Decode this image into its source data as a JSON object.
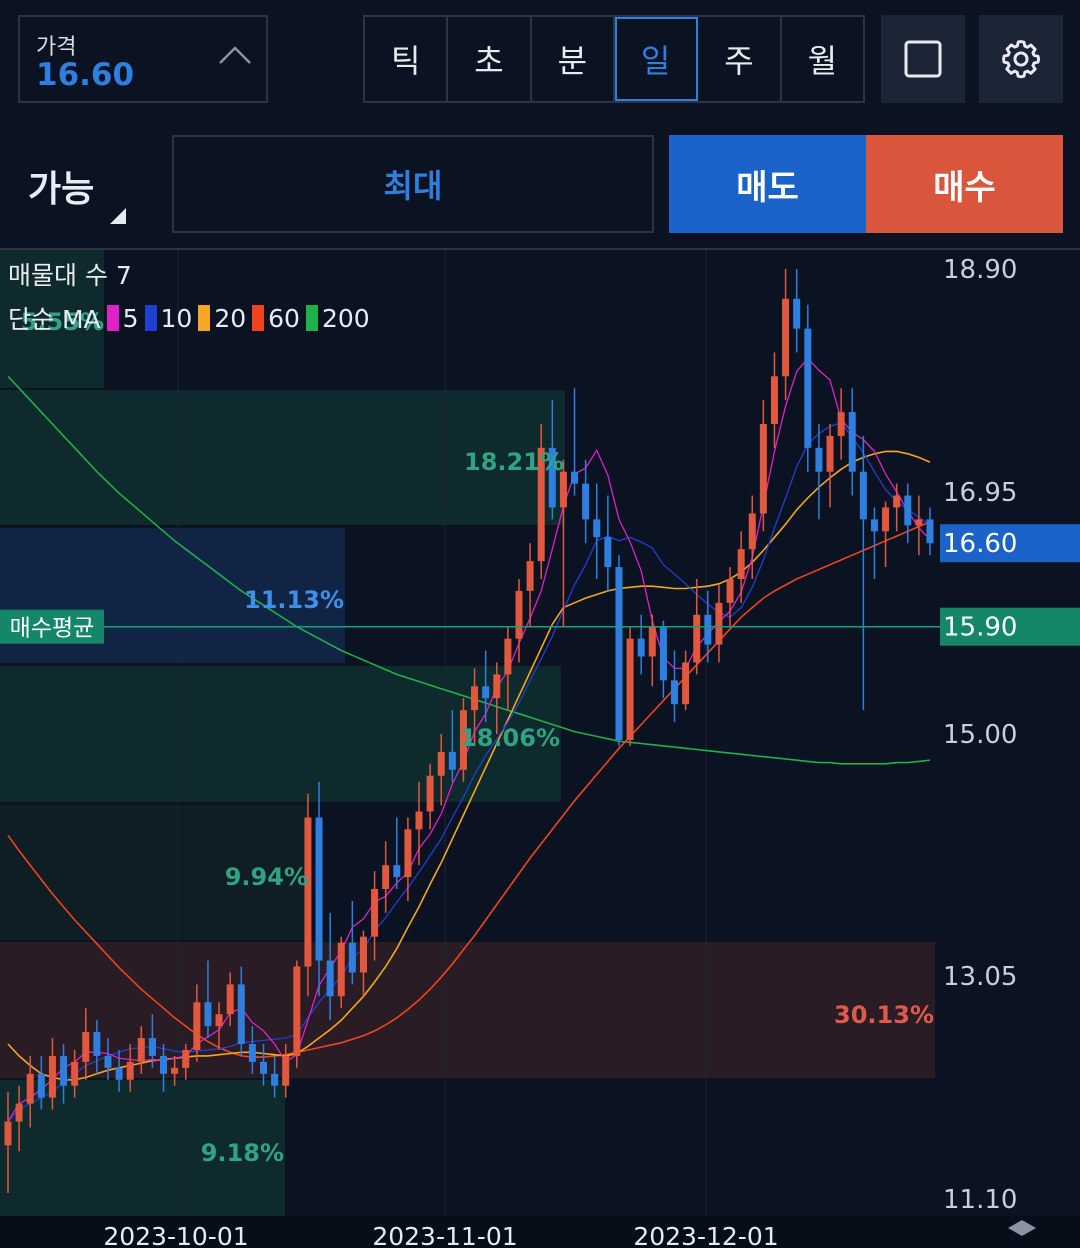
{
  "header": {
    "price_label": "가격",
    "price_value": "16.60",
    "timeframes": [
      {
        "label": "틱",
        "active": false
      },
      {
        "label": "초",
        "active": false
      },
      {
        "label": "분",
        "active": false
      },
      {
        "label": "일",
        "active": true
      },
      {
        "label": "주",
        "active": false
      },
      {
        "label": "월",
        "active": false
      }
    ],
    "fullscreen_icon": "square-icon",
    "settings_icon": "gear-icon"
  },
  "order": {
    "available_label": "가능",
    "max_label": "최대",
    "sell_label": "매도",
    "buy_label": "매수"
  },
  "indicators": {
    "volume_profile": "매물대 수 7",
    "ma_label": "단순 MA",
    "ma_periods": [
      {
        "period": "5",
        "color": "#e020c8"
      },
      {
        "period": "10",
        "color": "#1f3fd0"
      },
      {
        "period": "20",
        "color": "#f5a623"
      },
      {
        "period": "60",
        "color": "#f0441c"
      },
      {
        "period": "200",
        "color": "#1fb04a"
      }
    ]
  },
  "chart_data": {
    "type": "candlestick",
    "y_ticks": [
      "18.90",
      "16.95",
      "15.00",
      "13.05",
      "11.10"
    ],
    "x_ticks": [
      "2023-10-01",
      "2023-11-01",
      "2023-12-01"
    ],
    "ylim": [
      11.1,
      18.9
    ],
    "current_price": {
      "label": "16.60",
      "value": 16.6,
      "color": "#1b63c8"
    },
    "average_buy": {
      "label": "매수평균",
      "value_label": "15.90",
      "value": 15.9,
      "color": "#15a27a"
    },
    "volume_profile_percents": [
      "5.55%",
      "18.21%",
      "11.13%",
      "18.06%",
      "9.94%",
      "30.13%",
      "9.18%"
    ],
    "candle_colors": {
      "up": "#e2583e",
      "down": "#2f7fe0"
    },
    "candles": [
      [
        11.55,
        12.0,
        11.15,
        11.75
      ],
      [
        11.75,
        12.05,
        11.5,
        11.9
      ],
      [
        11.9,
        12.3,
        11.7,
        12.15
      ],
      [
        12.15,
        12.3,
        11.85,
        11.95
      ],
      [
        11.95,
        12.45,
        11.85,
        12.3
      ],
      [
        12.3,
        12.4,
        11.9,
        12.05
      ],
      [
        12.05,
        12.35,
        11.95,
        12.25
      ],
      [
        12.25,
        12.7,
        12.1,
        12.5
      ],
      [
        12.5,
        12.6,
        12.15,
        12.3
      ],
      [
        12.3,
        12.45,
        12.1,
        12.2
      ],
      [
        12.2,
        12.35,
        12.0,
        12.1
      ],
      [
        12.1,
        12.4,
        12.0,
        12.25
      ],
      [
        12.25,
        12.55,
        12.15,
        12.45
      ],
      [
        12.45,
        12.65,
        12.2,
        12.3
      ],
      [
        12.3,
        12.4,
        12.0,
        12.15
      ],
      [
        12.15,
        12.3,
        12.05,
        12.2
      ],
      [
        12.2,
        12.4,
        12.1,
        12.35
      ],
      [
        12.35,
        12.9,
        12.25,
        12.75
      ],
      [
        12.75,
        13.1,
        12.45,
        12.55
      ],
      [
        12.55,
        12.75,
        12.35,
        12.65
      ],
      [
        12.65,
        13.0,
        12.55,
        12.9
      ],
      [
        12.9,
        13.05,
        12.3,
        12.4
      ],
      [
        12.4,
        12.55,
        12.15,
        12.25
      ],
      [
        12.25,
        12.4,
        12.05,
        12.15
      ],
      [
        12.15,
        12.3,
        11.95,
        12.05
      ],
      [
        12.05,
        12.4,
        11.95,
        12.3
      ],
      [
        12.3,
        13.1,
        12.2,
        13.05
      ],
      [
        13.05,
        14.5,
        12.8,
        14.3
      ],
      [
        14.3,
        14.6,
        12.8,
        13.1
      ],
      [
        13.1,
        13.5,
        12.6,
        12.8
      ],
      [
        12.8,
        13.3,
        12.7,
        13.25
      ],
      [
        13.25,
        13.6,
        12.9,
        13.0
      ],
      [
        13.0,
        13.35,
        12.8,
        13.3
      ],
      [
        13.3,
        13.85,
        13.1,
        13.7
      ],
      [
        13.7,
        14.1,
        13.5,
        13.9
      ],
      [
        13.9,
        14.3,
        13.7,
        13.8
      ],
      [
        13.8,
        14.3,
        13.6,
        14.2
      ],
      [
        14.2,
        14.6,
        13.9,
        14.35
      ],
      [
        14.35,
        14.75,
        14.2,
        14.65
      ],
      [
        14.65,
        15.0,
        14.4,
        14.85
      ],
      [
        14.85,
        15.2,
        14.6,
        14.7
      ],
      [
        14.7,
        15.3,
        14.6,
        15.2
      ],
      [
        15.2,
        15.55,
        14.9,
        15.4
      ],
      [
        15.4,
        15.7,
        15.1,
        15.3
      ],
      [
        15.3,
        15.6,
        15.0,
        15.5
      ],
      [
        15.5,
        15.9,
        15.2,
        15.8
      ],
      [
        15.8,
        16.3,
        15.6,
        16.2
      ],
      [
        16.2,
        16.6,
        15.9,
        16.45
      ],
      [
        16.45,
        17.6,
        16.3,
        17.4
      ],
      [
        17.4,
        17.8,
        16.8,
        16.9
      ],
      [
        16.9,
        17.3,
        15.9,
        17.2
      ],
      [
        17.2,
        17.9,
        17.0,
        17.1
      ],
      [
        17.1,
        17.3,
        16.6,
        16.8
      ],
      [
        16.8,
        17.1,
        16.3,
        16.65
      ],
      [
        16.65,
        17.0,
        16.2,
        16.4
      ],
      [
        16.4,
        16.5,
        14.9,
        14.95
      ],
      [
        14.95,
        15.9,
        14.9,
        15.8
      ],
      [
        15.8,
        16.0,
        15.5,
        15.65
      ],
      [
        15.65,
        16.0,
        15.4,
        15.9
      ],
      [
        15.9,
        15.95,
        15.3,
        15.45
      ],
      [
        15.45,
        15.7,
        15.1,
        15.25
      ],
      [
        15.25,
        15.7,
        15.2,
        15.6
      ],
      [
        15.6,
        16.3,
        15.5,
        16.0
      ],
      [
        16.0,
        16.2,
        15.6,
        15.75
      ],
      [
        15.75,
        16.25,
        15.6,
        16.1
      ],
      [
        16.1,
        16.4,
        15.9,
        16.3
      ],
      [
        16.3,
        16.7,
        16.1,
        16.55
      ],
      [
        16.55,
        17.0,
        16.3,
        16.85
      ],
      [
        16.85,
        17.8,
        16.7,
        17.6
      ],
      [
        17.6,
        18.2,
        17.4,
        18.0
      ],
      [
        18.0,
        18.9,
        17.8,
        18.65
      ],
      [
        18.65,
        18.9,
        18.2,
        18.4
      ],
      [
        18.4,
        18.6,
        17.2,
        17.4
      ],
      [
        17.4,
        17.6,
        16.8,
        17.2
      ],
      [
        17.2,
        17.6,
        16.9,
        17.5
      ],
      [
        17.5,
        17.9,
        17.3,
        17.7
      ],
      [
        17.7,
        17.9,
        17.0,
        17.2
      ],
      [
        17.2,
        17.5,
        15.2,
        16.8
      ],
      [
        16.8,
        16.9,
        16.3,
        16.7
      ],
      [
        16.7,
        16.95,
        16.4,
        16.9
      ],
      [
        16.9,
        17.1,
        16.7,
        17.0
      ],
      [
        17.0,
        17.1,
        16.6,
        16.75
      ],
      [
        16.75,
        17.0,
        16.5,
        16.8
      ],
      [
        16.8,
        16.9,
        16.5,
        16.6
      ]
    ],
    "ma_values": {
      "ma5": [
        11.75,
        11.9,
        11.95,
        12.02,
        12.1,
        12.2,
        12.25,
        12.33,
        12.33,
        12.32,
        12.28,
        12.27,
        12.26,
        12.27,
        12.26,
        12.28,
        12.3,
        12.4,
        12.46,
        12.52,
        12.66,
        12.7,
        12.58,
        12.51,
        12.4,
        12.25,
        12.31,
        12.6,
        12.89,
        13.04,
        13.18,
        13.38,
        13.45,
        13.59,
        13.64,
        13.75,
        13.84,
        14.04,
        14.16,
        14.33,
        14.58,
        14.77,
        15.02,
        15.17,
        15.39,
        15.53,
        15.76,
        15.97,
        16.2,
        16.55,
        16.91,
        17.18,
        17.23,
        17.38,
        17.17,
        16.8,
        16.61,
        16.37,
        15.95,
        15.64,
        15.55,
        15.55,
        15.73,
        15.84,
        15.94,
        16.03,
        16.19,
        16.48,
        16.92,
        17.37,
        17.75,
        18.04,
        18.15,
        18.05,
        17.97,
        17.64,
        17.53,
        17.47,
        17.37,
        17.18,
        17.03,
        16.87,
        16.73,
        16.63
      ],
      "ma10": [
        11.75,
        11.85,
        11.9,
        11.95,
        12.0,
        12.08,
        12.15,
        12.22,
        12.26,
        12.3,
        12.33,
        12.36,
        12.37,
        12.38,
        12.36,
        12.34,
        12.33,
        12.34,
        12.35,
        12.36,
        12.38,
        12.41,
        12.42,
        12.43,
        12.44,
        12.45,
        12.48,
        12.62,
        12.75,
        12.86,
        12.97,
        13.12,
        13.2,
        13.35,
        13.46,
        13.59,
        13.71,
        13.84,
        13.98,
        14.12,
        14.3,
        14.47,
        14.66,
        14.82,
        14.96,
        15.1,
        15.26,
        15.45,
        15.63,
        15.82,
        16.04,
        16.25,
        16.42,
        16.62,
        16.66,
        16.62,
        16.65,
        16.61,
        16.56,
        16.42,
        16.34,
        16.26,
        16.17,
        16.09,
        16.02,
        15.98,
        16.06,
        16.23,
        16.46,
        16.73,
        16.98,
        17.24,
        17.43,
        17.52,
        17.58,
        17.61,
        17.49,
        17.36,
        17.2,
        17.05,
        16.95,
        16.88,
        16.82,
        16.75
      ],
      "ma20": [
        12.4,
        12.3,
        12.22,
        12.15,
        12.12,
        12.1,
        12.1,
        12.12,
        12.15,
        12.18,
        12.2,
        12.22,
        12.24,
        12.26,
        12.27,
        12.28,
        12.29,
        12.3,
        12.3,
        12.31,
        12.32,
        12.33,
        12.33,
        12.32,
        12.31,
        12.3,
        12.32,
        12.38,
        12.45,
        12.52,
        12.6,
        12.7,
        12.8,
        12.92,
        13.05,
        13.2,
        13.38,
        13.55,
        13.74,
        13.92,
        14.12,
        14.32,
        14.52,
        14.72,
        14.92,
        15.12,
        15.32,
        15.52,
        15.72,
        15.92,
        16.06,
        16.1,
        16.14,
        16.17,
        16.2,
        16.22,
        16.23,
        16.24,
        16.24,
        16.23,
        16.22,
        16.22,
        16.23,
        16.24,
        16.26,
        16.3,
        16.36,
        16.44,
        16.54,
        16.65,
        16.76,
        16.88,
        16.98,
        17.07,
        17.15,
        17.22,
        17.28,
        17.32,
        17.35,
        17.37,
        17.37,
        17.35,
        17.32,
        17.28
      ],
      "ma60": [
        14.15,
        14.02,
        13.9,
        13.78,
        13.66,
        13.55,
        13.44,
        13.34,
        13.24,
        13.14,
        13.04,
        12.95,
        12.86,
        12.78,
        12.7,
        12.62,
        12.55,
        12.48,
        12.42,
        12.37,
        12.33,
        12.3,
        12.29,
        12.29,
        12.3,
        12.31,
        12.33,
        12.35,
        12.37,
        12.39,
        12.41,
        12.44,
        12.47,
        12.51,
        12.56,
        12.62,
        12.69,
        12.77,
        12.86,
        12.96,
        13.07,
        13.19,
        13.31,
        13.44,
        13.57,
        13.7,
        13.83,
        13.96,
        14.08,
        14.2,
        14.32,
        14.44,
        14.55,
        14.66,
        14.77,
        14.88,
        14.98,
        15.08,
        15.18,
        15.28,
        15.38,
        15.48,
        15.58,
        15.68,
        15.78,
        15.88,
        15.98,
        16.06,
        16.14,
        16.2,
        16.25,
        16.3,
        16.34,
        16.38,
        16.42,
        16.46,
        16.5,
        16.54,
        16.58,
        16.62,
        16.66,
        16.7,
        16.74,
        16.78
      ],
      "ma200": [
        18.0,
        17.9,
        17.8,
        17.7,
        17.6,
        17.5,
        17.4,
        17.3,
        17.2,
        17.11,
        17.02,
        16.94,
        16.86,
        16.78,
        16.7,
        16.62,
        16.55,
        16.48,
        16.41,
        16.34,
        16.27,
        16.2,
        16.14,
        16.08,
        16.02,
        15.96,
        15.9,
        15.85,
        15.8,
        15.75,
        15.7,
        15.66,
        15.62,
        15.58,
        15.54,
        15.5,
        15.47,
        15.44,
        15.41,
        15.38,
        15.35,
        15.32,
        15.29,
        15.26,
        15.23,
        15.2,
        15.17,
        15.14,
        15.11,
        15.08,
        15.05,
        15.02,
        15.0,
        14.98,
        14.96,
        14.94,
        14.93,
        14.92,
        14.91,
        14.9,
        14.89,
        14.88,
        14.87,
        14.86,
        14.85,
        14.84,
        14.83,
        14.82,
        14.81,
        14.8,
        14.79,
        14.78,
        14.77,
        14.76,
        14.76,
        14.75,
        14.75,
        14.75,
        14.75,
        14.75,
        14.76,
        14.76,
        14.77,
        14.78
      ]
    }
  }
}
